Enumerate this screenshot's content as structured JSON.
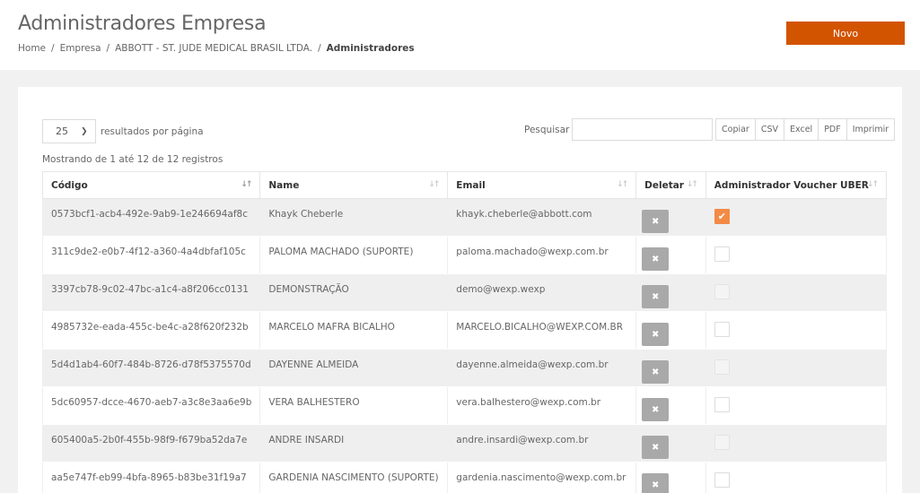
{
  "header": {
    "title": "Administradores Empresa",
    "new_button": "Novo",
    "breadcrumb": [
      "Home",
      "Empresa",
      "ABBOTT - ST. JUDE MEDICAL BRASIL LTDA.",
      "Administradores"
    ]
  },
  "table_controls": {
    "page_length": "25",
    "page_length_label": "resultados por página",
    "search_label": "Pesquisar",
    "search_value": "",
    "export_buttons": [
      "Copiar",
      "CSV",
      "Excel",
      "PDF",
      "Imprimir"
    ],
    "info": "Mostrando de 1 até 12 de 12 registros"
  },
  "table": {
    "columns": [
      "Código",
      "Name",
      "Email",
      "Deletar",
      "Administrador Voucher UBER"
    ],
    "rows": [
      {
        "codigo": "0573bcf1-acb4-492e-9ab9-1e246694af8c",
        "name": "Khayk Cheberle",
        "email": "khayk.cheberle@abbott.com",
        "voucher": "checked"
      },
      {
        "codigo": "311c9de2-e0b7-4f12-a360-4a4dbfaf105c",
        "name": "PALOMA MACHADO (SUPORTE)",
        "email": "paloma.machado@wexp.com.br",
        "voucher": "unchecked"
      },
      {
        "codigo": "3397cb78-9c02-47bc-a1c4-a8f206cc0131",
        "name": "DEMONSTRAÇÃO",
        "email": "demo@wexp.wexp",
        "voucher": "disabled"
      },
      {
        "codigo": "4985732e-eada-455c-be4c-a28f620f232b",
        "name": "MARCELO MAFRA BICALHO",
        "email": "MARCELO.BICALHO@WEXP.COM.BR",
        "voucher": "unchecked"
      },
      {
        "codigo": "5d4d1ab4-60f7-484b-8726-d78f5375570d",
        "name": "DAYENNE ALMEIDA",
        "email": "dayenne.almeida@wexp.com.br",
        "voucher": "disabled"
      },
      {
        "codigo": "5dc60957-dcce-4670-aeb7-a3c8e3aa6e9b",
        "name": "VERA BALHESTERO",
        "email": "vera.balhestero@wexp.com.br",
        "voucher": "unchecked"
      },
      {
        "codigo": "605400a5-2b0f-455b-98f9-f679ba52da7e",
        "name": "ANDRE INSARDI",
        "email": "andre.insardi@wexp.com.br",
        "voucher": "disabled"
      },
      {
        "codigo": "aa5e747f-eb99-4bfa-8965-b83be31f19a7",
        "name": "GARDENIA NASCIMENTO (SUPORTE)",
        "email": "gardenia.nascimento@wexp.com.br",
        "voucher": "unchecked"
      }
    ]
  },
  "icons": {
    "delete": "close-icon",
    "check": "checkmark-icon",
    "sort": "sort-arrows-icon",
    "dropdown": "chevron-down-icon"
  },
  "colors": {
    "accent": "#d35400",
    "checkbox_on": "#f28b46",
    "delete_button": "#a9a9a9"
  }
}
